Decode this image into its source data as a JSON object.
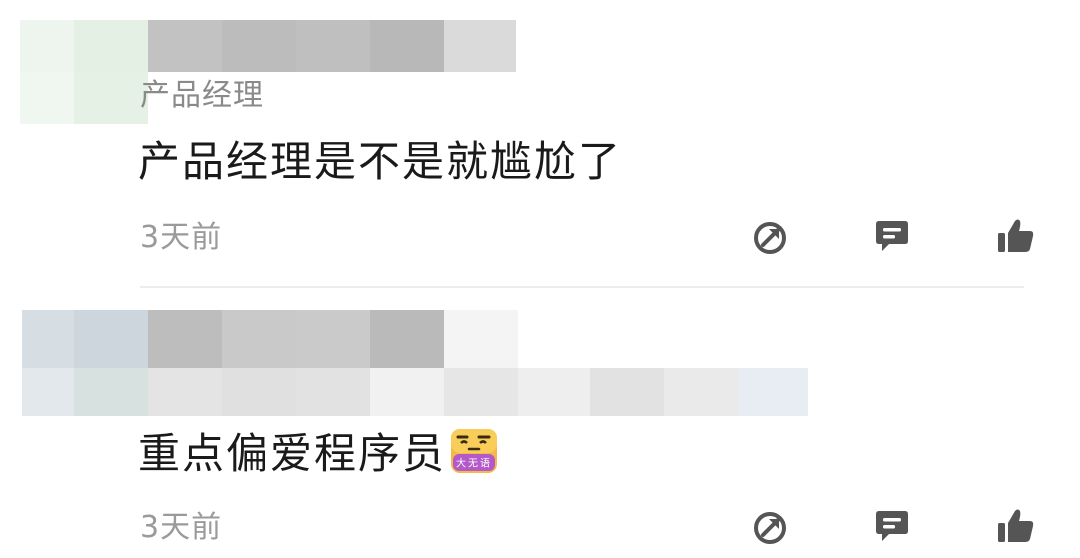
{
  "comments": [
    {
      "author_tag": "产品经理",
      "text": "产品经理是不是就尴尬了",
      "time": "3天前",
      "actions": [
        "share-icon",
        "reply-icon",
        "like-icon"
      ]
    },
    {
      "text": "重点偏爱程序员",
      "emoji": {
        "name": "speechless-emoji",
        "label": "大无语"
      },
      "time": "3天前",
      "actions": [
        "share-icon",
        "reply-icon",
        "like-icon"
      ]
    }
  ]
}
